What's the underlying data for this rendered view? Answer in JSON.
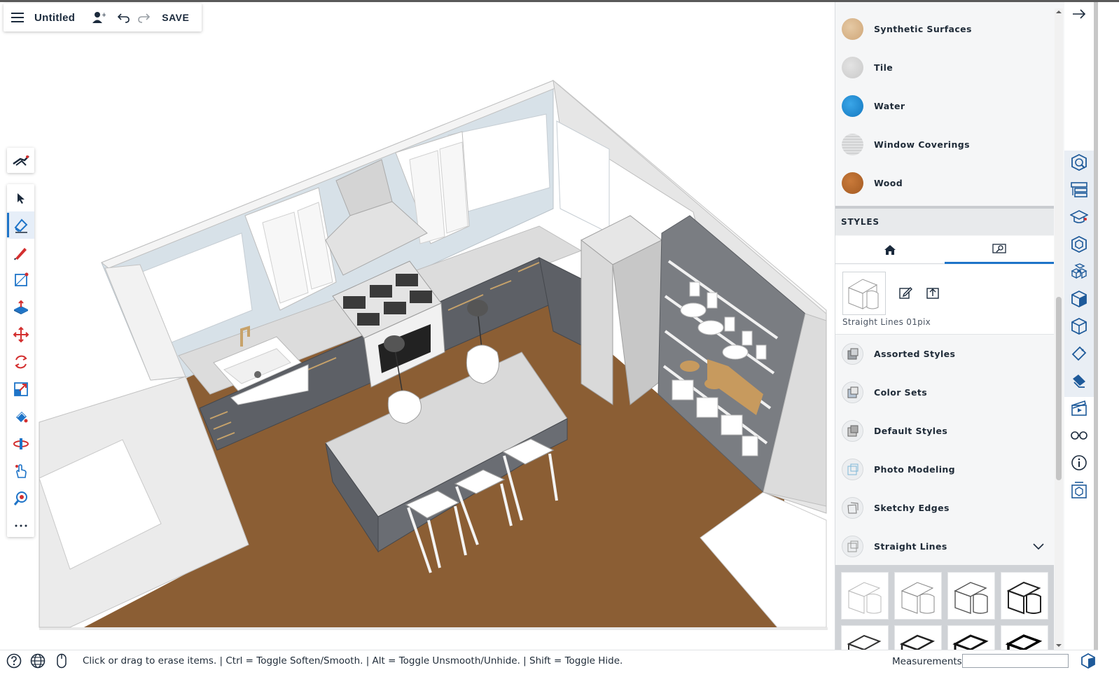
{
  "app": {
    "document_title": "Untitled",
    "save_label": "SAVE"
  },
  "materials": {
    "items": [
      {
        "label": "Synthetic Surfaces",
        "color": "#d8b48a"
      },
      {
        "label": "Tile",
        "color": "#d3d3d3"
      },
      {
        "label": "Water",
        "color": "#1f8fd6"
      },
      {
        "label": "Window Coverings",
        "color": "#d9dadb"
      },
      {
        "label": "Wood",
        "color": "#b5662a"
      }
    ]
  },
  "styles": {
    "header": "STYLES",
    "current_style_name": "Straight Lines 01pix",
    "collections": [
      {
        "label": "Assorted Styles"
      },
      {
        "label": "Color Sets"
      },
      {
        "label": "Default Styles"
      },
      {
        "label": "Photo Modeling"
      },
      {
        "label": "Sketchy Edges"
      },
      {
        "label": "Straight Lines"
      }
    ]
  },
  "status": {
    "hint": "Click or drag to erase items. | Ctrl = Toggle Soften/Smooth. | Alt = Toggle Unsmooth/Unhide. | Shift = Toggle Hide.",
    "measurements_label": "Measurements",
    "measurements_value": ""
  },
  "colors": {
    "accent": "#1e74c8",
    "floor": "#8b5e34",
    "cabinet": "#5d6066",
    "wall": "#eeeeee"
  }
}
